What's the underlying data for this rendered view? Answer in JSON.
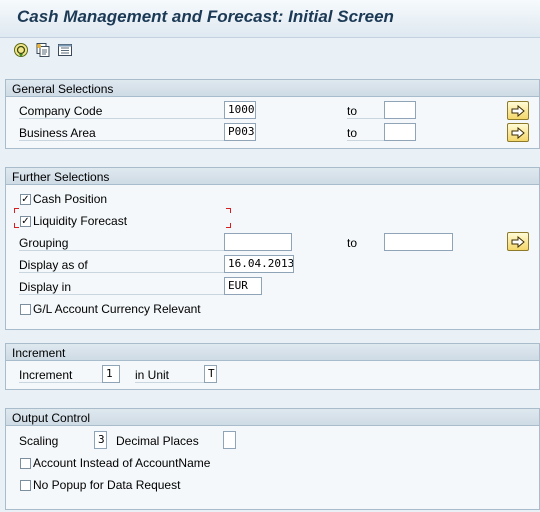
{
  "window": {
    "title": "Cash Management and Forecast: Initial Screen"
  },
  "toolbar": {
    "icons": [
      "execute-icon",
      "get-variant-icon",
      "selection-options-icon"
    ]
  },
  "general_selections": {
    "header": "General Selections",
    "company_code": {
      "label": "Company Code",
      "value": "1000",
      "to_label": "to",
      "to_value": ""
    },
    "business_area": {
      "label": "Business Area",
      "value": "P003",
      "to_label": "to",
      "to_value": ""
    }
  },
  "further_selections": {
    "header": "Further Selections",
    "cash_position": {
      "label": "Cash Position",
      "checked": true
    },
    "liquidity_forecast": {
      "label": "Liquidity Forecast",
      "checked": true
    },
    "grouping": {
      "label": "Grouping",
      "value": "",
      "to_label": "to",
      "to_value": ""
    },
    "display_as_of": {
      "label": "Display as of",
      "value": "16.04.2013"
    },
    "display_in": {
      "label": "Display in",
      "value": "EUR"
    },
    "gl_currency": {
      "label": "G/L Account Currency Relevant",
      "checked": false
    }
  },
  "increment": {
    "header": "Increment",
    "increment_label": "Increment",
    "increment_value": "1",
    "unit_label": "in Unit",
    "unit_value": "T"
  },
  "output_control": {
    "header": "Output Control",
    "scaling_label": "Scaling",
    "scaling_value": "3",
    "decimal_label": "Decimal Places",
    "decimal_value": "",
    "account_instead": {
      "label": "Account Instead of AccountName",
      "checked": false
    },
    "no_popup": {
      "label": "No Popup for Data Request",
      "checked": false
    }
  },
  "colors": {
    "title": "#1c3a55",
    "background": "#eaf1f6",
    "group_header": "#cfdbe5",
    "multiple_selection_button": "#f4d76a",
    "focus_marker": "#d62020"
  }
}
